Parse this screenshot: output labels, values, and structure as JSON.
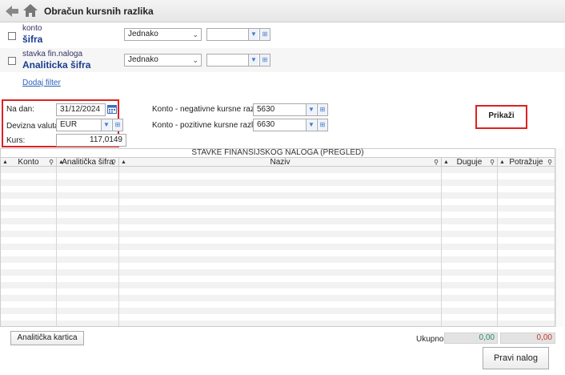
{
  "window": {
    "title": "Obračun kursnih razlika"
  },
  "filters": [
    {
      "small_label": "konto",
      "big_label": "šifra",
      "operator": "Jednako",
      "value": ""
    },
    {
      "small_label": "stavka fin.naloga",
      "big_label": "Analiticka šifra",
      "operator": "Jednako",
      "value": ""
    }
  ],
  "add_filter_label": "Dodaj filter",
  "params": {
    "na_dan_label": "Na dan:",
    "na_dan_value": "31/12/2024",
    "devizna_label": "Devizna valuta:",
    "devizna_value": "EUR",
    "kurs_label": "Kurs:",
    "kurs_value": "117,0149",
    "konto_neg_label": "Konto - negativne kursne razlike:",
    "konto_neg_value": "5630",
    "konto_poz_label": "Konto - pozitivne kursne razlike:",
    "konto_poz_value": "6630"
  },
  "show_button": "Prikaži",
  "grid": {
    "title": "STAVKE FINANSIJSKOG NALOGA (PREGLED)",
    "columns": [
      "Konto",
      "Analitička šifra",
      "Naziv",
      "Duguje",
      "Potražuje"
    ]
  },
  "footer": {
    "analytic_button": "Analitička kartica",
    "total_label": "Ukupno:",
    "total_duguje": "0,00",
    "total_potrazuje": "0,00",
    "total_duguje_color": "#2a8a6a",
    "total_potrazuje_color": "#c0392b",
    "post_button": "Pravi nalog"
  },
  "icons": {
    "back": "back-arrow-icon",
    "home": "home-icon",
    "calendar": "calendar-icon",
    "dropdown": "chevron-down-icon",
    "lookup": "lookup-icon",
    "sort": "sort-icon",
    "search": "search-icon"
  }
}
